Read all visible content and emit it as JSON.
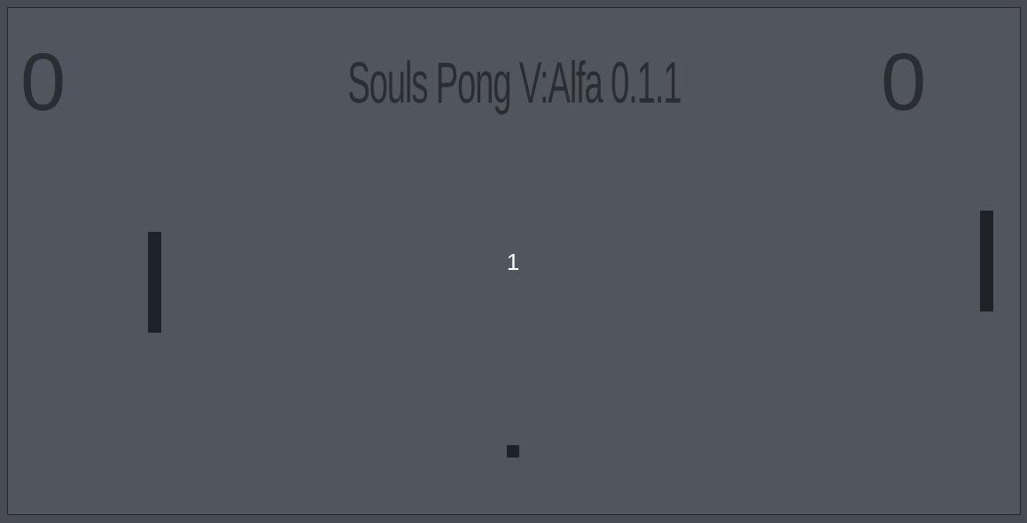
{
  "game": {
    "title": "Souls Pong V:Alfa 0.1.1",
    "score_left": "0",
    "score_right": "0",
    "countdown": "1"
  },
  "colors": {
    "background": "#51555e",
    "outer": "#484b53",
    "text_dark": "#2a2d34",
    "paddle": "#1f2228",
    "countdown": "#ffffff"
  }
}
